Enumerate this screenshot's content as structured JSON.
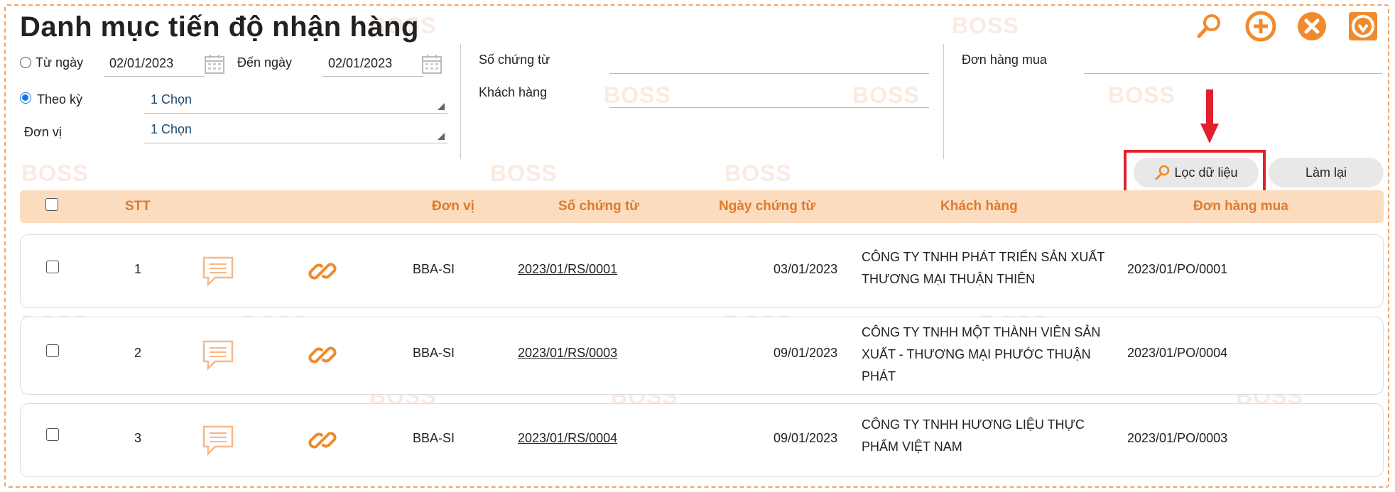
{
  "page_title": "Danh mục tiến độ nhận hàng",
  "watermark": "BOSS",
  "filters": {
    "tu_ngay_label": "Từ ngày",
    "tu_ngay_value": "02/01/2023",
    "den_ngay_label": "Đến ngày",
    "den_ngay_value": "02/01/2023",
    "theo_ky_label": "Theo kỳ",
    "theo_ky_value": "1 Chọn",
    "don_vi_label": "Đơn vị",
    "don_vi_value": "1 Chọn",
    "so_chung_tu_label": "Số chứng từ",
    "so_chung_tu_value": "",
    "khach_hang_label": "Khách hàng",
    "khach_hang_value": "",
    "don_hang_mua_label": "Đơn hàng mua",
    "don_hang_mua_value": "",
    "selected_mode": "theo_ky"
  },
  "buttons": {
    "loc_du_lieu": "Lọc dữ liệu",
    "lam_lai": "Làm lại"
  },
  "table": {
    "headers": {
      "stt": "STT",
      "don_vi": "Đơn vị",
      "so_chung_tu": "Số chứng từ",
      "ngay_chung_tu": "Ngày chứng từ",
      "khach_hang": "Khách hàng",
      "don_hang_mua": "Đơn hàng mua"
    },
    "rows": [
      {
        "stt": "1",
        "don_vi": "BBA-SI",
        "so_chung_tu": "2023/01/RS/0001",
        "ngay_chung_tu": "03/01/2023",
        "khach_hang": "CÔNG TY TNHH PHÁT TRIỂN SẢN XUẤT THƯƠNG MẠI THUẬN THIÊN",
        "don_hang_mua": "2023/01/PO/0001"
      },
      {
        "stt": "2",
        "don_vi": "BBA-SI",
        "so_chung_tu": "2023/01/RS/0003",
        "ngay_chung_tu": "09/01/2023",
        "khach_hang": "CÔNG TY TNHH MỘT THÀNH VIÊN SẢN XUẤT - THƯƠNG MẠI PHƯỚC THUẬN PHÁT",
        "don_hang_mua": "2023/01/PO/0004"
      },
      {
        "stt": "3",
        "don_vi": "BBA-SI",
        "so_chung_tu": "2023/01/RS/0004",
        "ngay_chung_tu": "09/01/2023",
        "khach_hang": "CÔNG TY TNHH HƯƠNG LIỆU THỰC PHẨM VIỆT NAM",
        "don_hang_mua": "2023/01/PO/0003"
      }
    ]
  },
  "colors": {
    "accent": "#f08a2c",
    "header_bg": "#fbdcbf",
    "header_text": "#e07a2c",
    "highlight": "#e0212b"
  }
}
